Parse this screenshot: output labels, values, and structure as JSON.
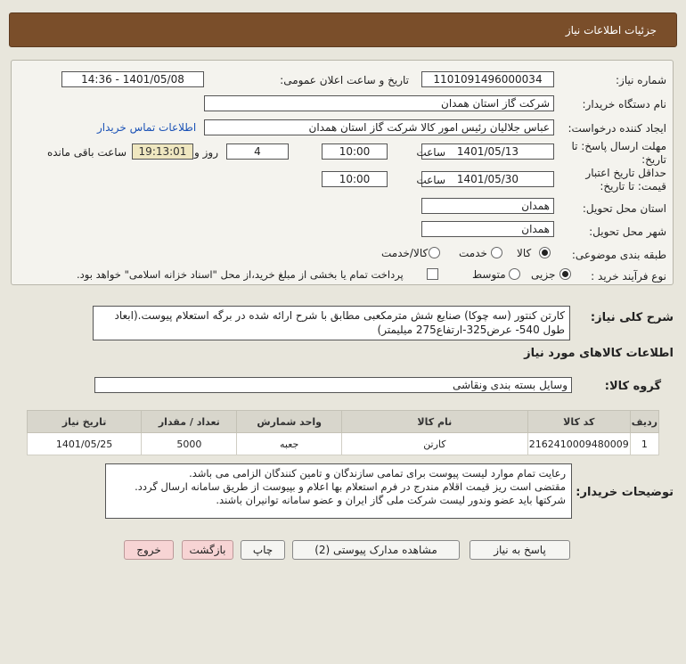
{
  "header": {
    "title": "جزئیات اطلاعات نیاز"
  },
  "form": {
    "need_number_label": "شماره نیاز:",
    "need_number": "1101091496000034",
    "announce_label": "تاریخ و ساعت اعلان عمومی:",
    "announce_value": "1401/05/08 - 14:36",
    "buyer_org_label": "نام دستگاه خریدار:",
    "buyer_org": "شرکت گاز استان همدان",
    "requester_label": "ایجاد کننده درخواست:",
    "requester": "عباس جلالیان رئیس امور کالا شرکت گاز استان همدان",
    "contact_link": "اطلاعات تماس خریدار",
    "reply_deadline_label_1": "مهلت ارسال پاسخ: تا",
    "reply_deadline_label_2": "تاریخ:",
    "reply_date": "1401/05/13",
    "time_label": "ساعت",
    "reply_time": "10:00",
    "days_value": "4",
    "days_label": "روز و",
    "remaining_time": "19:13:01",
    "remaining_label": "ساعت باقی مانده",
    "validity_label_1": "حداقل تاریخ اعتبار",
    "validity_label_2": "قیمت: تا تاریخ:",
    "validity_date": "1401/05/30",
    "validity_time": "10:00",
    "province_label": "استان محل تحویل:",
    "province": "همدان",
    "city_label": "شهر محل تحویل:",
    "city": "همدان",
    "category_label": "طبقه بندی موضوعی:",
    "category_options": [
      "کالا",
      "خدمت",
      "کالا/خدمت"
    ],
    "process_label": "نوع فرآیند خرید :",
    "process_options": [
      "جزیی",
      "متوسط"
    ],
    "treasury_note": "پرداخت تمام یا بخشی از مبلغ خرید،از محل \"اسناد خزانه اسلامی\" خواهد بود."
  },
  "description": {
    "label": "شرح کلی نیاز:",
    "text": "کارتن کنتور (سه چوکا) صنایع شش مترمکعبی  مطابق با شرح ارائه شده در برگه استعلام پیوست.(ابعاد طول 540- عرض325-ارتفاع275 میلیمتر)"
  },
  "goods": {
    "section_title": "اطلاعات کالاهای مورد نیاز",
    "group_label": "گروه کالا:",
    "group_value": "وسایل بسته بندی  ونقاشی",
    "columns": [
      "ردیف",
      "کد کالا",
      "نام کالا",
      "واحد شمارش",
      "تعداد / مقدار",
      "تاریخ نیاز"
    ],
    "rows": [
      [
        "1",
        "2162410009480009",
        "کارتن",
        "جعبه",
        "5000",
        "1401/05/25"
      ]
    ]
  },
  "buyer_notes": {
    "label": "توضیحات خریدار:",
    "lines": [
      "رعایت تمام موارد لیست پیوست برای تمامی سازندگان و تامین کنندگان الزامی می باشد.",
      "مقتضی است ریز قیمت اقلام مندرج در فرم استعلام بها اعلام و بپیوست از طریق سامانه ارسال گردد.",
      "شرکتها باید عضو وندور لیست شرکت ملی گاز  ایران و عضو سامانه توانیران  باشند."
    ]
  },
  "buttons": {
    "reply": "پاسخ به نیاز",
    "attachments": "مشاهده مدارک پیوستی (2)",
    "print": "چاپ",
    "back": "بازگشت",
    "exit": "خروج"
  },
  "colors": {
    "header_bg": "#7a4e2a",
    "link": "#1b52b6",
    "page_bg": "#e8e6dc"
  }
}
